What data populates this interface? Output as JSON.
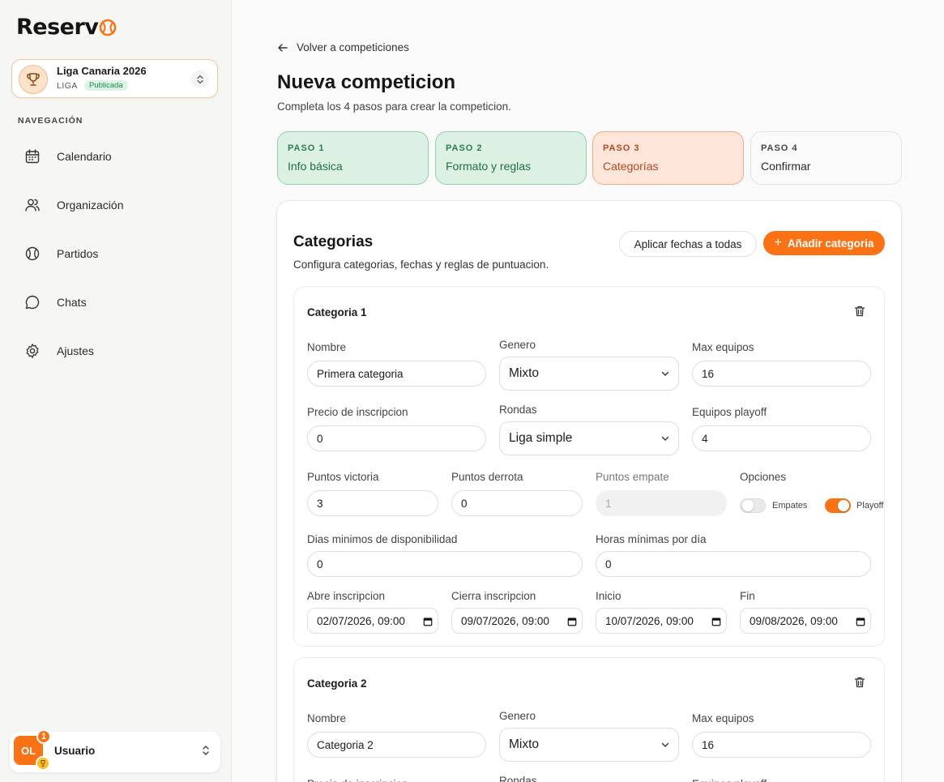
{
  "app": {
    "logo_text": "Reserv"
  },
  "league": {
    "name": "Liga Canaria 2026",
    "type": "LIGA",
    "status": "Publicada"
  },
  "nav": {
    "title": "NAVEGACIÓN",
    "items": [
      {
        "label": "Calendario",
        "icon": "calendar-icon"
      },
      {
        "label": "Organización",
        "icon": "users-icon"
      },
      {
        "label": "Partidos",
        "icon": "ball-icon"
      },
      {
        "label": "Chats",
        "icon": "chat-icon"
      },
      {
        "label": "Ajustes",
        "icon": "gear-icon"
      }
    ]
  },
  "user": {
    "initials": "OL",
    "name": "Usuario",
    "notifications": "1"
  },
  "header": {
    "back_label": "Volver a competiciones",
    "title": "Nueva competicion",
    "subtitle": "Completa los 4 pasos para crear la competicion."
  },
  "steps": [
    {
      "num": "PASO 1",
      "label": "Info básica",
      "state": "done"
    },
    {
      "num": "PASO 2",
      "label": "Formato y reglas",
      "state": "done"
    },
    {
      "num": "PASO 3",
      "label": "Categorías",
      "state": "active"
    },
    {
      "num": "PASO 4",
      "label": "Confirmar",
      "state": "pending"
    }
  ],
  "categories_panel": {
    "title": "Categorias",
    "subtitle": "Configura categorias, fechas y reglas de puntuacion.",
    "apply_dates_label": "Aplicar fechas a todas",
    "add_label": "Añadir categoria"
  },
  "labels": {
    "nombre": "Nombre",
    "genero": "Genero",
    "max_equipos": "Max equipos",
    "precio": "Precio de inscripcion",
    "rondas": "Rondas",
    "equipos_playoff": "Equipos playoff",
    "puntos_victoria": "Puntos victoria",
    "puntos_derrota": "Puntos derrota",
    "puntos_empate": "Puntos empate",
    "opciones": "Opciones",
    "empates": "Empates",
    "playoff": "Playoff",
    "dias_min": "Dias minimos de disponibilidad",
    "horas_min": "Horas mínimas por día",
    "abre": "Abre inscripcion",
    "cierra": "Cierra inscripcion",
    "inicio": "Inicio",
    "fin": "Fin"
  },
  "cat1": {
    "title": "Categoria 1",
    "nombre": "Primera categoria",
    "genero": "Mixto",
    "max_equipos": "16",
    "precio": "0",
    "rondas": "Liga simple",
    "equipos_playoff": "4",
    "puntos_victoria": "3",
    "puntos_derrota": "0",
    "puntos_empate": "1",
    "empates_on": false,
    "playoff_on": true,
    "dias_min": "0",
    "horas_min": "0",
    "abre": "02/07/2026, 09:00",
    "cierra": "09/07/2026, 09:00",
    "inicio": "10/07/2026, 09:00",
    "fin": "09/08/2026, 09:00"
  },
  "cat2": {
    "title": "Categoria 2",
    "nombre": "Categoria 2",
    "genero": "Mixto",
    "max_equipos": "16"
  },
  "colors": {
    "accent": "#f97316",
    "done_bg": "#dcf1e4",
    "active_bg": "#fde5da"
  }
}
